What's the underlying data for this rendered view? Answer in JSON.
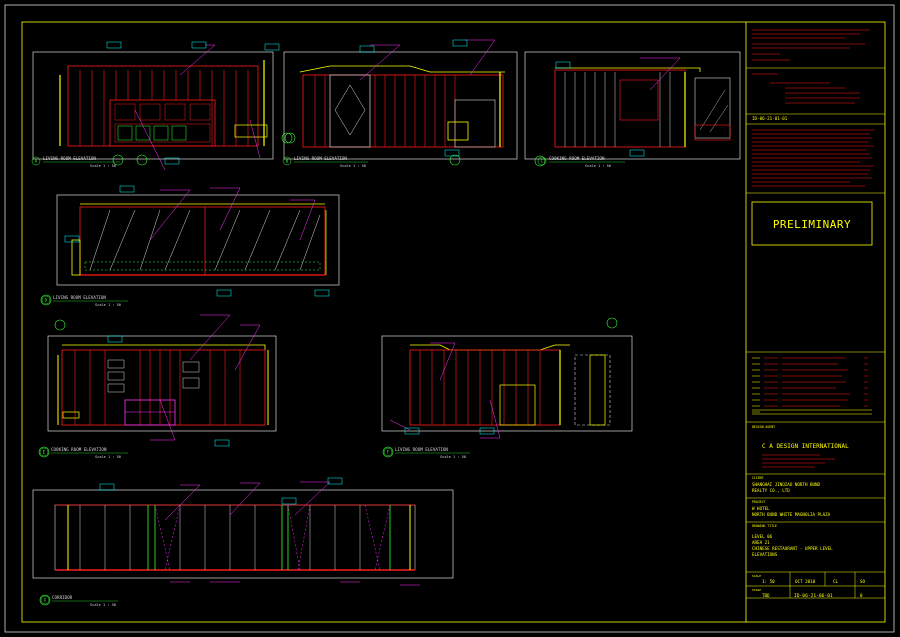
{
  "colors": {
    "background": "#000000",
    "frame": "#d8d8d8",
    "border": "#ffff00",
    "wall": "#ff1a1a",
    "annotation": "#ff33ff",
    "tag": "#00ffff",
    "glass": "#ffffff",
    "green": "#33ff33",
    "panel": "#c0c0c0"
  },
  "elevations": [
    {
      "number": "A",
      "title": "LIVING ROOM ELEVATION",
      "scale": "Scale 1 : 50"
    },
    {
      "number": "B",
      "title": "LIVING ROOM ELEVATION",
      "scale": "Scale 1 : 50"
    },
    {
      "number": "C",
      "title": "COOKING ROOM ELEVATION",
      "scale": "Scale 1 : 50"
    },
    {
      "number": "D",
      "title": "LIVING ROOM ELEVATION",
      "scale": "Scale 1 : 50"
    },
    {
      "number": "E",
      "title": "COOKING ROOM ELEVATION",
      "scale": "Scale 1 : 50"
    },
    {
      "number": "F",
      "title": "LIVING ROOM ELEVATION",
      "scale": "Scale 1 : 50"
    },
    {
      "number": "G",
      "title": "CORRIDOR",
      "scale": "Scale 1 : 50"
    }
  ],
  "title_block": {
    "stamp": "PRELIMINARY",
    "design_firm_label": "DESIGN AGENT",
    "design_firm": "C A DESIGN INTERNATIONAL",
    "client_label": "CLIENT",
    "client_line1": "SHANGHAI JINQIAO NORTH BUND",
    "client_line2": "REALTY CO., LTD",
    "project_label": "PROJECT",
    "project_line1": "W HOTEL",
    "project_line2": "NORTH BUND WHITE MAGNOLIA PLAZA",
    "drawing_label": "DRAWING TITLE",
    "drawing_line1": "LEVEL 06",
    "drawing_line2": "AREA 21",
    "drawing_line3": "CHINESE RESTAURANT - UPPER LEVEL",
    "drawing_line4": "ELEVATIONS",
    "scale_label": "SCALE",
    "scale": "1: 50",
    "date": "OCT 2010",
    "drawn": "CL",
    "checked": "SO",
    "stage_label": "STAGE",
    "stage": "TBD",
    "drawing_no": "ID-06-21-06-01",
    "revision": "0",
    "ref_no": "ID-06-21-01-01"
  }
}
